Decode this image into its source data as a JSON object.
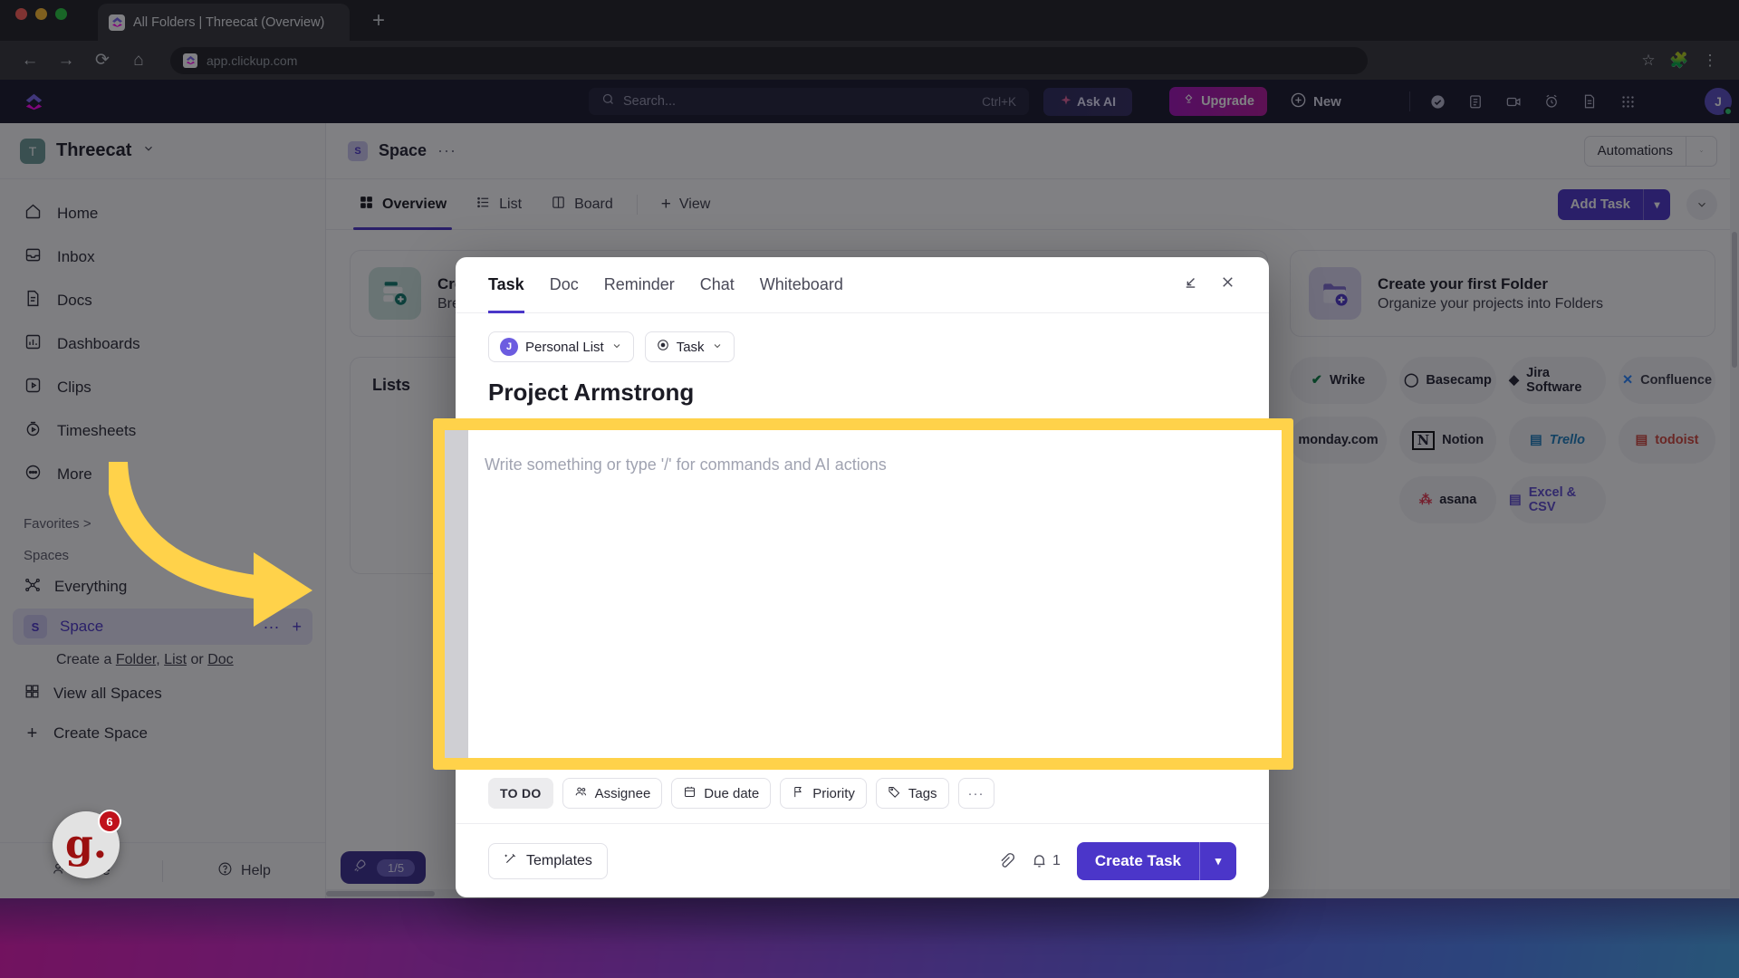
{
  "browser": {
    "tab_title": "All Folders | Threecat (Overview)",
    "new_tab_label": "+",
    "url": "app.clickup.com",
    "back_icon": "back-arrow-icon",
    "forward_icon": "forward-arrow-icon",
    "reload_icon": "reload-icon",
    "home_icon": "home-icon",
    "star_icon": "bookmark-star-icon",
    "extensions_icon": "extensions-puzzle-icon",
    "menu_icon": "kebab-menu-icon"
  },
  "topbar": {
    "search_placeholder": "Search...",
    "search_shortcut": "Ctrl+K",
    "ask_ai": "Ask AI",
    "upgrade": "Upgrade",
    "new": "New",
    "avatar_initial": "J",
    "icons": [
      "check-circle-icon",
      "notepad-icon",
      "video-clip-icon",
      "alarm-clock-icon",
      "document-icon",
      "apps-grid-icon"
    ]
  },
  "sidebar": {
    "workspace_initial": "T",
    "workspace_name": "Threecat",
    "nav": [
      {
        "label": "Home",
        "icon": "home-icon"
      },
      {
        "label": "Inbox",
        "icon": "inbox-icon"
      },
      {
        "label": "Docs",
        "icon": "docs-icon"
      },
      {
        "label": "Dashboards",
        "icon": "dashboards-icon"
      },
      {
        "label": "Clips",
        "icon": "clips-icon"
      },
      {
        "label": "Timesheets",
        "icon": "timesheets-icon"
      },
      {
        "label": "More",
        "icon": "more-ellipsis-icon"
      }
    ],
    "favorites_label": "Favorites >",
    "spaces_label": "Spaces",
    "everything_label": "Everything",
    "space_initial": "S",
    "space_label": "Space",
    "create_hint": {
      "prefix": "Create a ",
      "folder": "Folder",
      "comma": ", ",
      "list": "List",
      "or": " or ",
      "doc": "Doc"
    },
    "view_all_spaces": "View all Spaces",
    "create_space": "Create Space",
    "invite": "Invite",
    "help": "Help"
  },
  "space_header": {
    "badge": "S",
    "name": "Space",
    "dots": "···",
    "automations": "Automations"
  },
  "view_bar": {
    "tabs": [
      {
        "label": "Overview",
        "icon": "overview-grid-icon",
        "active": true
      },
      {
        "label": "List",
        "icon": "list-icon",
        "active": false
      },
      {
        "label": "Board",
        "icon": "board-icon",
        "active": false
      }
    ],
    "add_view": "View",
    "add_task": "Add Task"
  },
  "content": {
    "cta_left": {
      "title": "Create your first List",
      "subtitle": "Break down projects into Lists"
    },
    "cta_right": {
      "title": "Create your first Folder",
      "subtitle": "Organize your projects into Folders"
    },
    "lists_title": "Lists",
    "integrations": [
      "Wrike",
      "Basecamp",
      "Jira Software",
      "Confluence",
      "monday.com",
      "Notion",
      "Trello",
      "todoist",
      "",
      "asana",
      "Excel & CSV"
    ],
    "rocket_progress": "1/5"
  },
  "modal": {
    "tabs": [
      "Task",
      "Doc",
      "Reminder",
      "Chat",
      "Whiteboard"
    ],
    "active_tab": "Task",
    "minimize_icon": "minimize-icon",
    "close_icon": "close-icon",
    "list_pill": {
      "avatar": "J",
      "label": "Personal List"
    },
    "type_pill": {
      "label": "Task"
    },
    "title": "Project Armstrong",
    "description_placeholder": "Write something or type '/' for commands and AI actions",
    "fields": [
      {
        "label": "TO DO",
        "icon": ""
      },
      {
        "label": "Assignee",
        "icon": "assignee-icon"
      },
      {
        "label": "Due date",
        "icon": "calendar-icon"
      },
      {
        "label": "Priority",
        "icon": "flag-icon"
      },
      {
        "label": "Tags",
        "icon": "tag-icon"
      },
      {
        "label": "···",
        "icon": ""
      }
    ],
    "templates": "Templates",
    "attachment_icon": "paperclip-icon",
    "notify_icon": "bell-icon",
    "notify_count": "1",
    "create_task": "Create Task"
  },
  "widget": {
    "letter": "g.",
    "badge": "6"
  },
  "colors": {
    "accent_purple": "#4b36c9",
    "highlight_yellow": "#ffd24a",
    "upgrade_magenta": "#b4179b",
    "topbar_navy": "#18182a"
  }
}
